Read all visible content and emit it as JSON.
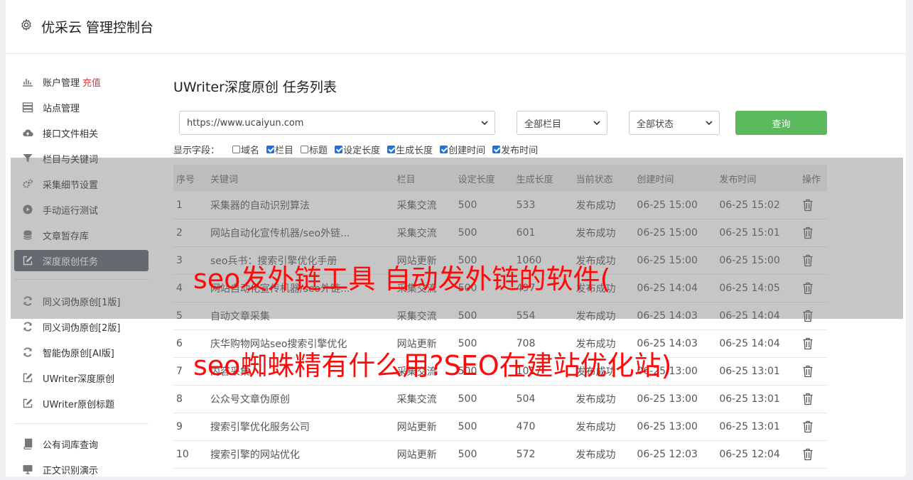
{
  "app": {
    "title": "优采云 管理控制台"
  },
  "sidebar": {
    "group1": [
      {
        "label": "账户管理",
        "extra": "充值",
        "icon": "bar-chart-icon"
      },
      {
        "label": "站点管理",
        "icon": "server-icon"
      },
      {
        "label": "接口文件相关",
        "icon": "cloud-upload-icon"
      },
      {
        "label": "栏目与关键词",
        "icon": "filter-icon"
      },
      {
        "label": "采集细节设置",
        "icon": "gears-icon"
      },
      {
        "label": "手动运行测试",
        "icon": "play-circle-icon"
      },
      {
        "label": "文章暂存库",
        "icon": "database-icon"
      },
      {
        "label": "深度原创任务",
        "icon": "edit-icon",
        "active": true
      }
    ],
    "group2": [
      {
        "label": "同义词伪原创[1版]",
        "icon": "refresh-icon"
      },
      {
        "label": "同义词伪原创[2版]",
        "icon": "refresh-icon"
      },
      {
        "label": "智能伪原创[AI版]",
        "icon": "refresh-icon"
      },
      {
        "label": "UWriter深度原创",
        "icon": "edit-icon"
      },
      {
        "label": "UWriter原创标题",
        "icon": "edit-icon"
      }
    ],
    "group3": [
      {
        "label": "公有词库查询",
        "icon": "book-icon"
      },
      {
        "label": "正文识别演示",
        "icon": "monitor-icon"
      }
    ]
  },
  "main": {
    "title": "UWriter深度原创 任务列表",
    "site_select": "https://www.ucaiyun.com",
    "column_select": "全部栏目",
    "status_select": "全部状态",
    "query_button": "查询",
    "fields_label": "显示字段：",
    "fields": [
      {
        "label": "域名",
        "checked": false
      },
      {
        "label": "栏目",
        "checked": true
      },
      {
        "label": "标题",
        "checked": false
      },
      {
        "label": "设定长度",
        "checked": true
      },
      {
        "label": "生成长度",
        "checked": true
      },
      {
        "label": "创建时间",
        "checked": true
      },
      {
        "label": "发布时间",
        "checked": true
      }
    ],
    "table": {
      "headers": [
        "序号",
        "关键词",
        "栏目",
        "设定长度",
        "生成长度",
        "当前状态",
        "创建时间",
        "发布时间",
        "操作"
      ],
      "rows": [
        [
          "1",
          "采集器的自动识别算法",
          "采集交流",
          "500",
          "533",
          "发布成功",
          "06-25 15:00",
          "06-25 15:02"
        ],
        [
          "2",
          "网站自动化宣传机器/seo外链...",
          "采集交流",
          "500",
          "601",
          "发布成功",
          "06-25 15:00",
          "06-25 15:01"
        ],
        [
          "3",
          "seo兵书：搜索引擎优化手册",
          "网站更新",
          "500",
          "1060",
          "发布成功",
          "06-25 15:00",
          "06-25 15:00"
        ],
        [
          "4",
          "网站自动化宣传机器/seo外链...",
          "采集交流",
          "500",
          "497",
          "发布成功",
          "06-25 14:04",
          "06-25 14:05"
        ],
        [
          "5",
          "自动文章采集",
          "采集交流",
          "500",
          "554",
          "发布成功",
          "06-25 14:03",
          "06-25 14:04"
        ],
        [
          "6",
          "庆华购物网站seo搜索引擎优化",
          "网站更新",
          "500",
          "708",
          "发布成功",
          "06-25 14:03",
          "06-25 14:04"
        ],
        [
          "7",
          "内容采集",
          "采集交流",
          "500",
          "1017",
          "发布成功",
          "06-25 13:00",
          "06-25 13:01"
        ],
        [
          "8",
          "公众号文章伪原创",
          "采集交流",
          "500",
          "504",
          "发布成功",
          "06-25 13:00",
          "06-25 13:01"
        ],
        [
          "9",
          "搜索引擎优化服务公司",
          "网站更新",
          "500",
          "470",
          "发布成功",
          "06-25 13:00",
          "06-25 13:01"
        ],
        [
          "10",
          "搜索引擎的网站优化",
          "网站更新",
          "500",
          "572",
          "发布成功",
          "06-25 12:03",
          "06-25 12:04"
        ]
      ]
    }
  },
  "overlay": {
    "line1": "seo发外链工具 自动发外链的软件(",
    "line2": "seo蜘蛛精有什么用?SEO在建站优化站)"
  },
  "colors": {
    "primary_button": "#5cb85c",
    "success": "#3ba03b",
    "recharge": "#e03b3b",
    "watermark": "#ff0a0a"
  }
}
